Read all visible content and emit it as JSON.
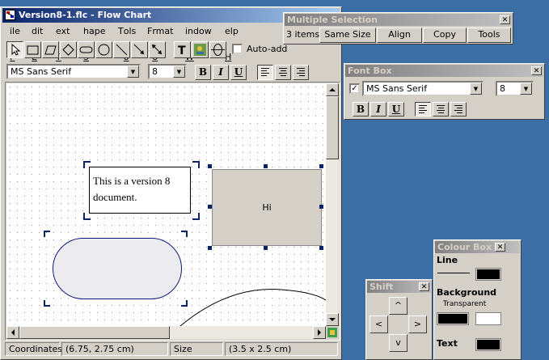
{
  "main_window": {
    "title": "Version8-1.flc - Flow Chart",
    "menu": [
      "File",
      "Edit",
      "Text",
      "Shape",
      "Tools",
      "Format",
      "Window",
      "Help"
    ],
    "auto_add_label": "Auto-add",
    "font_name": "MS Sans Serif",
    "font_size": "8",
    "bold": "B",
    "italic": "I",
    "underline": "U"
  },
  "canvas": {
    "text_box": "This is a version 8 document.",
    "rect_label": "Hi"
  },
  "status_bar": {
    "coord_label": "Coordinates",
    "coord_value": "(6.75, 2.75 cm)",
    "size_label": "Size",
    "size_value": "(3.5 x 2.5 cm)"
  },
  "multiple_selection": {
    "title": "Multiple Selection",
    "count": "3 items",
    "buttons": [
      "Same Size",
      "Align",
      "Copy",
      "Tools"
    ]
  },
  "font_box": {
    "title": "Font Box",
    "font_name": "MS Sans Serif",
    "font_size": "8",
    "bold": "B",
    "italic": "I",
    "underline": "U"
  },
  "colour_box": {
    "title": "Colour Box",
    "line_label": "Line",
    "background_label": "Background",
    "transparent_label": "Transparent",
    "text_label": "Text",
    "line_color": "#000000",
    "background_color": "#000000",
    "text_color": "#000000"
  },
  "shift": {
    "title": "Shift",
    "up": "^",
    "left": "<",
    "right": ">",
    "down": "v"
  }
}
